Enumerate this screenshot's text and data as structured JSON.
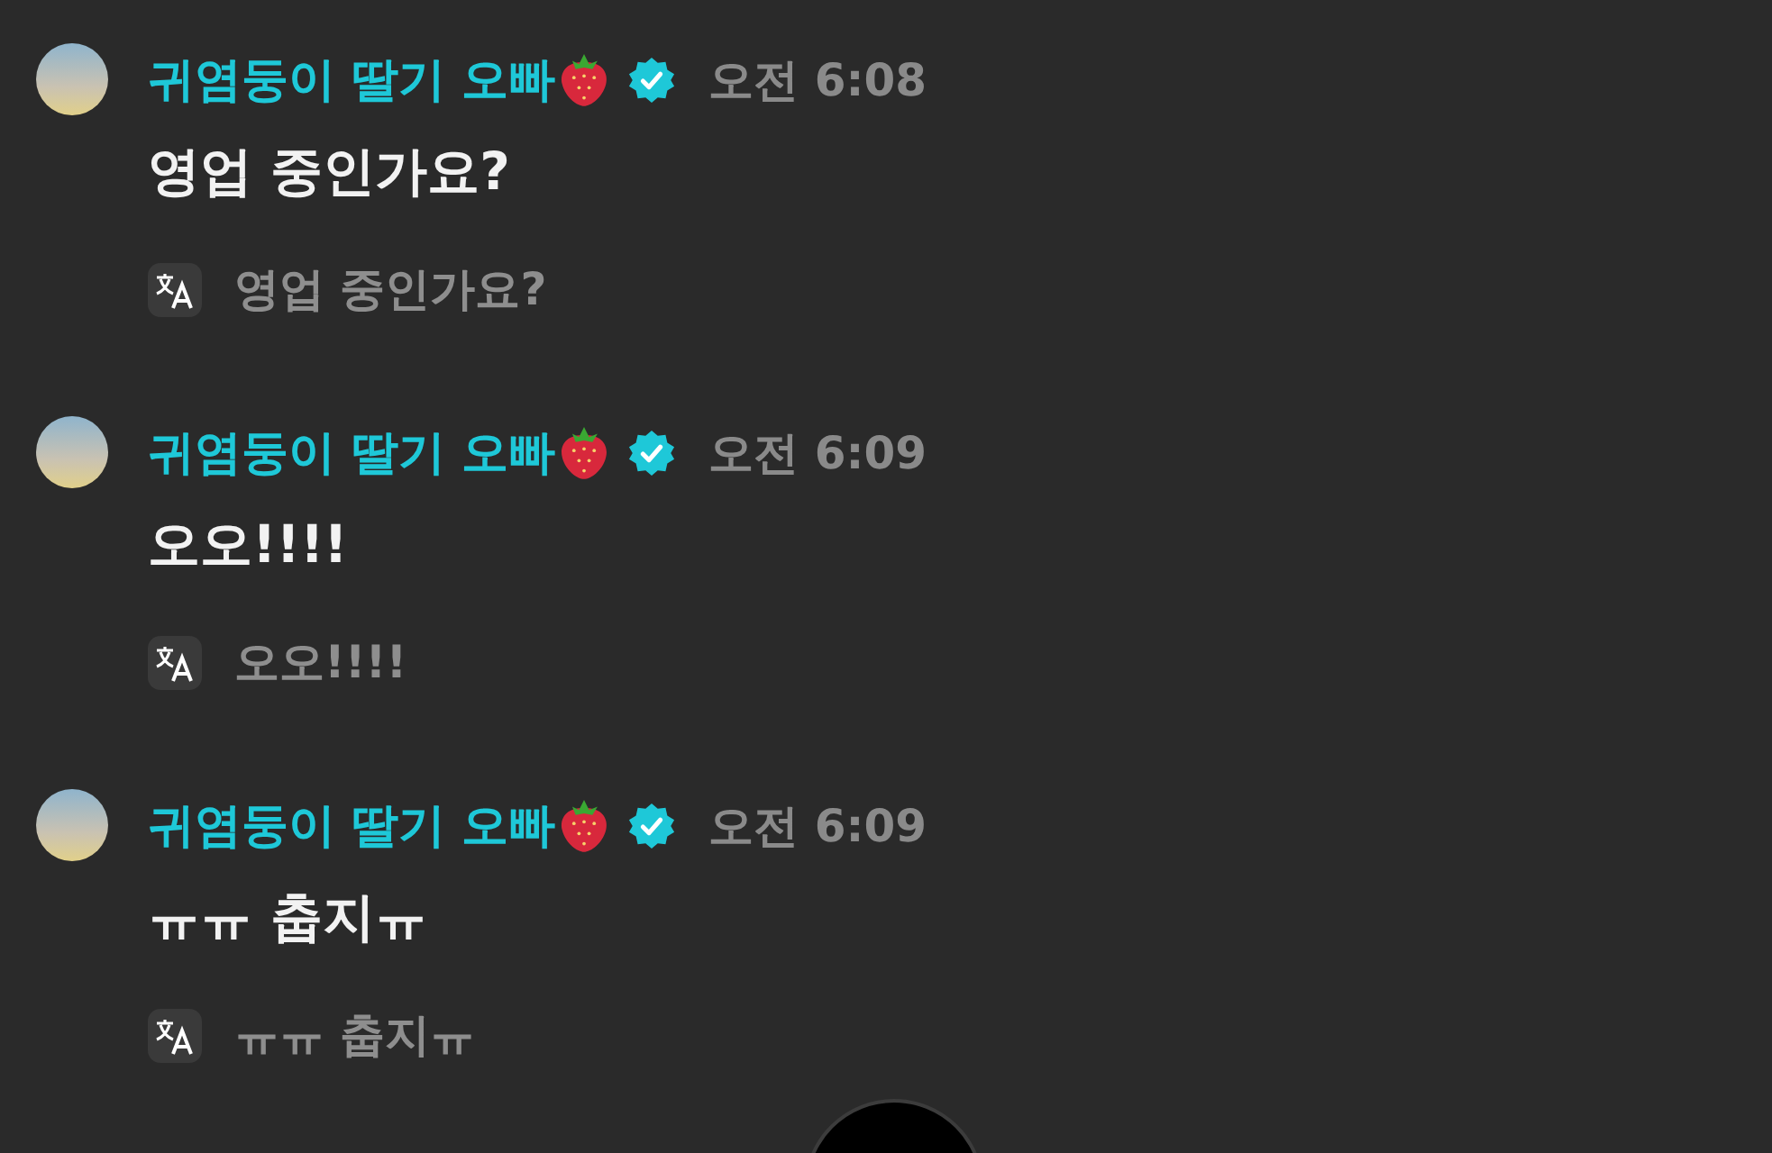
{
  "messages": [
    {
      "author": "귀염둥이 딸기 오빠",
      "verified": true,
      "time": "오전 6:08",
      "text": "영업 중인가요?",
      "translation": "영업 중인가요?"
    },
    {
      "author": "귀염둥이 딸기 오빠",
      "verified": true,
      "time": "오전 6:09",
      "text": "오오!!!!",
      "translation": "오오!!!!"
    },
    {
      "author": "귀염둥이 딸기 오빠",
      "verified": true,
      "time": "오전 6:09",
      "text": "ㅠㅠ 춥지ㅠ",
      "translation": "ㅠㅠ 춥지ㅠ"
    }
  ]
}
